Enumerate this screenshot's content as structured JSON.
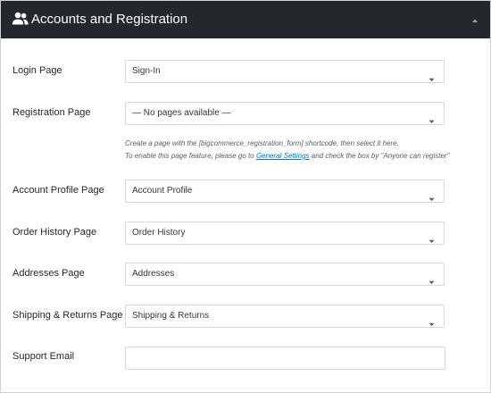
{
  "header": {
    "title": "Accounts and Registration",
    "icon": "users-icon",
    "collapse_icon": "caret-up-icon"
  },
  "fields": {
    "login": {
      "label": "Login Page",
      "value": "Sign-In"
    },
    "registration": {
      "label": "Registration Page",
      "value": "— No pages available —",
      "help_line1": "Create a page with the [bigcommerce_registration_form] shortcode, then select it here.",
      "help_line2_before": "To enable this page feature, please go to ",
      "help_line2_link": "General Settings",
      "help_line2_after": " and check the box by \"Anyone can register\""
    },
    "account_profile": {
      "label": "Account Profile Page",
      "value": "Account Profile"
    },
    "order_history": {
      "label": "Order History Page",
      "value": "Order History"
    },
    "addresses": {
      "label": "Addresses Page",
      "value": "Addresses"
    },
    "shipping_returns": {
      "label": "Shipping & Returns Page",
      "value": "Shipping & Returns"
    },
    "support_email": {
      "label": "Support Email",
      "value": ""
    }
  },
  "colors": {
    "header_bg": "#23282d",
    "link": "#0073aa",
    "border": "#d6d8db"
  }
}
